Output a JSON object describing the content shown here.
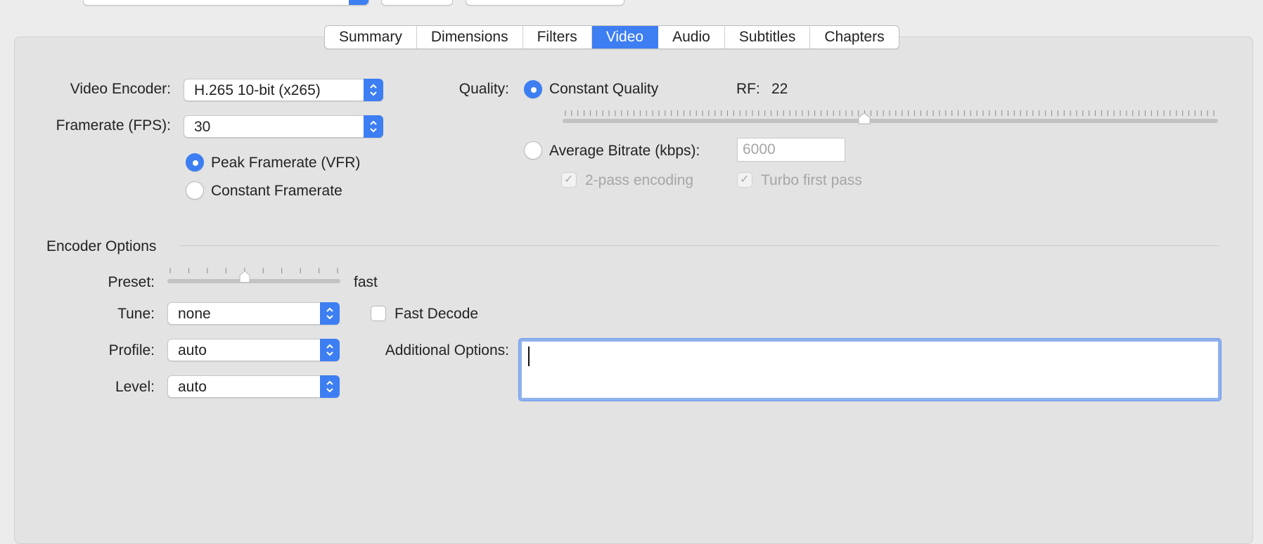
{
  "tabs": [
    {
      "label": "Summary",
      "active": false
    },
    {
      "label": "Dimensions",
      "active": false
    },
    {
      "label": "Filters",
      "active": false
    },
    {
      "label": "Video",
      "active": true
    },
    {
      "label": "Audio",
      "active": false
    },
    {
      "label": "Subtitles",
      "active": false
    },
    {
      "label": "Chapters",
      "active": false
    }
  ],
  "video": {
    "encoder_label": "Video Encoder:",
    "encoder_value": "H.265 10-bit (x265)",
    "framerate_label": "Framerate (FPS):",
    "framerate_value": "30",
    "peak_framerate_label": "Peak Framerate (VFR)",
    "peak_framerate_selected": true,
    "constant_framerate_label": "Constant Framerate",
    "constant_framerate_selected": false
  },
  "quality": {
    "label": "Quality:",
    "constant_quality_label": "Constant Quality",
    "constant_quality_selected": true,
    "rf_label": "RF:",
    "rf_value": "22",
    "rf_slider_fraction": 0.46,
    "average_bitrate_label": "Average Bitrate (kbps):",
    "average_bitrate_selected": false,
    "bitrate_placeholder": "6000",
    "two_pass_label": "2-pass encoding",
    "two_pass_checked": true,
    "turbo_label": "Turbo first pass",
    "turbo_checked": true
  },
  "encoder_options": {
    "section_title": "Encoder Options",
    "preset_label": "Preset:",
    "preset_value": "fast",
    "preset_slider_fraction": 0.45,
    "tune_label": "Tune:",
    "tune_value": "none",
    "fast_decode_label": "Fast Decode",
    "fast_decode_checked": false,
    "profile_label": "Profile:",
    "profile_value": "auto",
    "level_label": "Level:",
    "level_value": "auto",
    "additional_options_label": "Additional Options:",
    "additional_options_value": ""
  },
  "colors": {
    "accent": "#3d7ef2",
    "panel": "#e3e3e3",
    "window": "#ececec",
    "disabled_text": "#a6a6a6"
  }
}
